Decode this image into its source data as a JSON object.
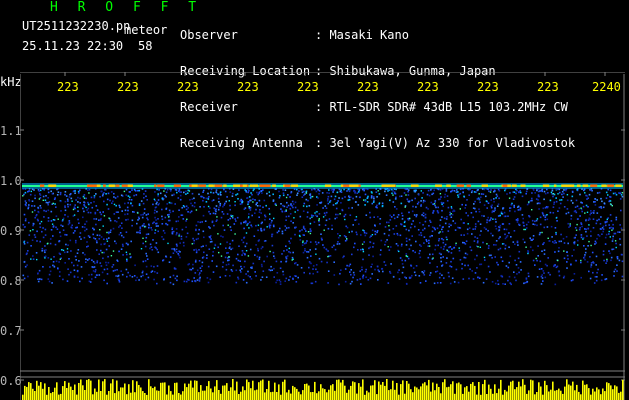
{
  "header": {
    "title": "H R O F F T",
    "file_id": "UT2511232230.pn",
    "meteor_label": "meteor",
    "date_time": "25.11.23 22:30",
    "count_value": "58",
    "info": {
      "labels": [
        "Observer",
        "Receiving Location",
        "Receiver",
        "Receiving Antenna"
      ],
      "values": [
        ": Masaki Kano",
        ": Shibukawa, Gunma, Japan",
        ": RTL-SDR SDR# 43dB L15 103.2MHz CW",
        ": 3el Yagi(V) Az 330 for Vladivostok"
      ]
    }
  },
  "axis": {
    "unit": "kHz",
    "y_ticks": [
      "1.1",
      "1.0",
      "0.9",
      "0.8",
      "0.7",
      "0.6"
    ],
    "x_ticks": [
      "223",
      "223",
      "223",
      "223",
      "223",
      "223",
      "223",
      "223",
      "223",
      "2240"
    ]
  },
  "colors": {
    "background": "#000000",
    "title": "#00ff00",
    "text": "#ffffff",
    "ticks_x": "#ffff00",
    "ticks_y": "#b4b4b4",
    "echo_line": "#ffd700",
    "noise_band": "#1e3cff",
    "bottom_bars": "#ffff00"
  }
}
